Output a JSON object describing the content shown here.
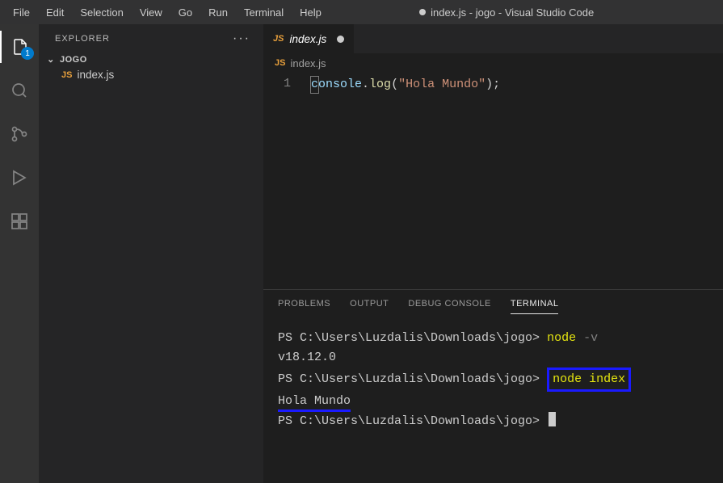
{
  "menubar": {
    "items": [
      "File",
      "Edit",
      "Selection",
      "View",
      "Go",
      "Run",
      "Terminal",
      "Help"
    ],
    "windowTitle": "index.js - jogo - Visual Studio Code"
  },
  "activitybar": {
    "explorerBadge": "1"
  },
  "sidebar": {
    "title": "EXPLORER",
    "folderName": "JOGO",
    "files": [
      {
        "name": "index.js",
        "langIcon": "JS"
      }
    ]
  },
  "editor": {
    "tab": {
      "name": "index.js",
      "langIcon": "JS",
      "modified": true
    },
    "breadcrumb": {
      "name": "index.js",
      "langIcon": "JS"
    },
    "lineNumbers": [
      "1"
    ],
    "code": {
      "ident": "onsole",
      "firstChar": "c",
      "dot": ".",
      "method": "log",
      "openParen": "(",
      "string": "\"Hola Mundo\"",
      "closeParen": ")",
      "semi": ";"
    }
  },
  "panel": {
    "tabs": [
      "PROBLEMS",
      "OUTPUT",
      "DEBUG CONSOLE",
      "TERMINAL"
    ],
    "activeTab": 3,
    "terminal": {
      "prompt": "PS C:\\Users\\Luzdalis\\Downloads\\jogo>",
      "cmd1": "node",
      "flag1": "-v",
      "out1": "v18.12.0",
      "cmd2": "node index",
      "out2": "Hola Mundo"
    }
  }
}
